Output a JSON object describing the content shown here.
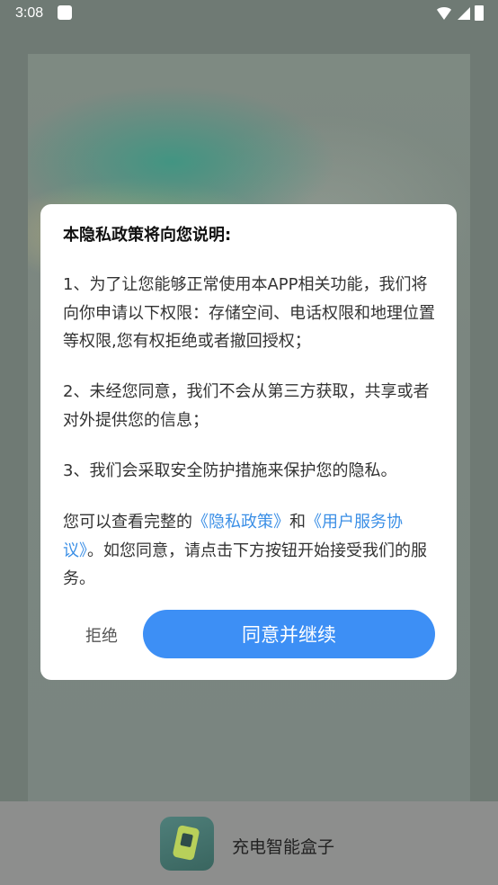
{
  "status_bar": {
    "time": "3:08"
  },
  "dialog": {
    "title": "本隐私政策将向您说明:",
    "para1": "1、为了让您能够正常使用本APP相关功能，我们将向你申请以下权限：存储空间、电话权限和地理位置等权限,您有权拒绝或者撤回授权；",
    "para2": "2、未经您同意，我们不会从第三方获取，共享或者对外提供您的信息；",
    "para3": "3、我们会采取安全防护措施来保护您的隐私。",
    "para4_prefix": "您可以查看完整的",
    "privacy_link": "《隐私政策》",
    "para4_and": "和",
    "terms_link": "《用户服务协议》",
    "para4_suffix": "。如您同意，请点击下方按钮开始接受我们的服务。",
    "reject_label": "拒绝",
    "agree_label": "同意并继续"
  },
  "bottom_bar": {
    "app_name": "充电智能盒子"
  },
  "colors": {
    "accent": "#3d8ff5",
    "link": "#3b8fe6"
  }
}
